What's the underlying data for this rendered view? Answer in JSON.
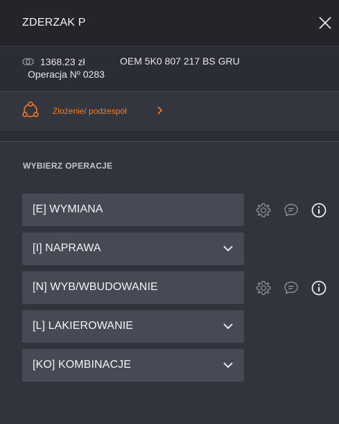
{
  "header": {
    "title": "ZDERZAK P",
    "close_icon": "close-icon"
  },
  "info": {
    "price": "1368.23 zł",
    "price_icon": "coin-icon",
    "oem": "OEM 5K0 807 217 BS GRU",
    "operation": "Operacja Nº 0283"
  },
  "assembly": {
    "label": "Złożenie/ podzespół",
    "icon": "assembly-icon",
    "accent_color": "#f07c2a"
  },
  "operations": {
    "heading": "WYBIERZ OPERACJE",
    "items": [
      {
        "label": "[E] WYMIANA",
        "type": "actions",
        "icons": [
          "gear-icon",
          "comment-icon",
          "info-icon"
        ]
      },
      {
        "label": "[I] NAPRAWA",
        "type": "dropdown",
        "icons": [
          "chevron-down-icon"
        ]
      },
      {
        "label": "[N] WYB/WBUDOWANIE",
        "type": "actions",
        "icons": [
          "gear-icon",
          "comment-icon",
          "info-icon"
        ]
      },
      {
        "label": "[L] LAKIEROWANIE",
        "type": "dropdown",
        "icons": [
          "chevron-down-icon"
        ]
      },
      {
        "label": "[KO] KOMBINACJE",
        "type": "dropdown",
        "icons": [
          "chevron-down-icon"
        ]
      }
    ]
  }
}
